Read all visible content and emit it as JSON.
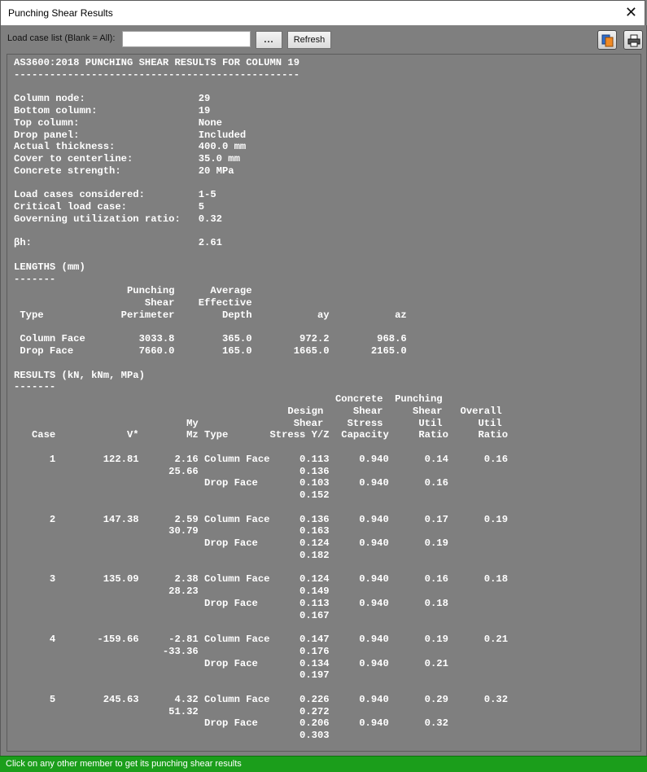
{
  "window": {
    "title": "Punching Shear Results",
    "close_glyph": "✕"
  },
  "toolbar": {
    "load_case_label": "Load case list (Blank = All):",
    "load_case_value": "",
    "browse_label": "...",
    "refresh_label": "Refresh",
    "copy_icon": "copy-icon",
    "print_icon": "print-icon"
  },
  "report": {
    "lines": [
      "AS3600:2018 PUNCHING SHEAR RESULTS FOR COLUMN 19",
      "------------------------------------------------",
      "",
      "Column node:                   29",
      "Bottom column:                 19",
      "Top column:                    None",
      "Drop panel:                    Included",
      "Actual thickness:              400.0 mm",
      "Cover to centerline:           35.0 mm",
      "Concrete strength:             20 MPa",
      "",
      "Load cases considered:         1-5",
      "Critical load case:            5",
      "Governing utilization ratio:   0.32",
      "",
      "βh:                            2.61",
      "",
      "LENGTHS (mm)",
      "-------",
      "                   Punching      Average",
      "                      Shear    Effective",
      " Type             Perimeter        Depth           ay           az",
      "",
      " Column Face         3033.8        365.0        972.2        968.6",
      " Drop Face           7660.0        165.0       1665.0       2165.0",
      "",
      "RESULTS (kN, kNm, MPa)",
      "-------",
      "                                                      Concrete  Punching",
      "                                              Design     Shear     Shear   Overall",
      "                             My                Shear    Stress      Util      Util",
      "   Case            V*        Mz Type       Stress Y/Z  Capacity     Ratio     Ratio",
      "",
      "      1        122.81      2.16 Column Face     0.113     0.940      0.14      0.16",
      "                          25.66                 0.136",
      "                                Drop Face       0.103     0.940      0.16",
      "                                                0.152",
      "",
      "      2        147.38      2.59 Column Face     0.136     0.940      0.17      0.19",
      "                          30.79                 0.163",
      "                                Drop Face       0.124     0.940      0.19",
      "                                                0.182",
      "",
      "      3        135.09      2.38 Column Face     0.124     0.940      0.16      0.18",
      "                          28.23                 0.149",
      "                                Drop Face       0.113     0.940      0.18",
      "                                                0.167",
      "",
      "      4       -159.66     -2.81 Column Face     0.147     0.940      0.19      0.21",
      "                         -33.36                 0.176",
      "                                Drop Face       0.134     0.940      0.21",
      "                                                0.197",
      "",
      "      5        245.63      4.32 Column Face     0.226     0.940      0.29      0.32",
      "                          51.32                 0.272",
      "                                Drop Face       0.206     0.940      0.32",
      "                                                0.303"
    ]
  },
  "status": {
    "text": "Click on any other member to get its punching shear results",
    "color": "#1b9e1b"
  }
}
